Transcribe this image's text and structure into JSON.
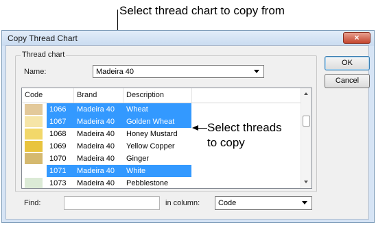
{
  "callouts": {
    "top": "Select thread chart to copy from",
    "right_line1": "Select threads",
    "right_line2": "to copy"
  },
  "window": {
    "title": "Copy Thread Chart",
    "close_glyph": "×"
  },
  "thread_chart": {
    "group_label": "Thread chart",
    "name_label": "Name:",
    "name_value": "Madeira 40"
  },
  "buttons": {
    "ok": "OK",
    "cancel": "Cancel"
  },
  "list": {
    "columns": [
      "Code",
      "Brand",
      "Description"
    ],
    "rows": [
      {
        "code": "1066",
        "brand": "Madeira 40",
        "description": "Wheat",
        "selected": true,
        "swatch": "#e3c99a"
      },
      {
        "code": "1067",
        "brand": "Madeira 40",
        "description": "Golden Wheat",
        "selected": true,
        "swatch": "#f6e5a7"
      },
      {
        "code": "1068",
        "brand": "Madeira 40",
        "description": "Honey Mustard",
        "selected": false,
        "swatch": "#f2d86a"
      },
      {
        "code": "1069",
        "brand": "Madeira 40",
        "description": "Yellow Copper",
        "selected": false,
        "swatch": "#e9c43e"
      },
      {
        "code": "1070",
        "brand": "Madeira 40",
        "description": "Ginger",
        "selected": false,
        "swatch": "#d5b96f"
      },
      {
        "code": "1071",
        "brand": "Madeira 40",
        "description": "White",
        "selected": true,
        "swatch": "#ffffff"
      },
      {
        "code": "1073",
        "brand": "Madeira 40",
        "description": "Pebblestone",
        "selected": false,
        "swatch": "#dbead6"
      }
    ]
  },
  "find": {
    "label": "Find:",
    "value": "",
    "in_column_label": "in column:",
    "column_value": "Code"
  },
  "colors": {
    "selection": "#3399ff",
    "dialog_frame": "#d6e4f5"
  }
}
